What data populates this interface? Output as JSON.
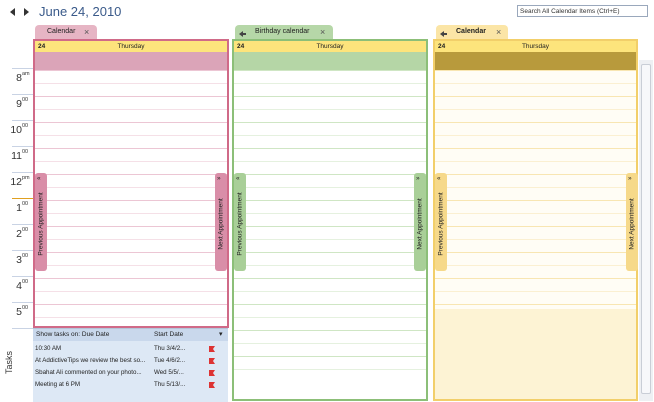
{
  "header": {
    "date_title": "June 24, 2010",
    "search_placeholder": "Search All Calendar Items (Ctrl+E)"
  },
  "time_slots": [
    {
      "h": "8",
      "m": "am"
    },
    {
      "h": "9",
      "m": "00"
    },
    {
      "h": "10",
      "m": "00"
    },
    {
      "h": "11",
      "m": "00"
    },
    {
      "h": "12",
      "m": "pm"
    },
    {
      "h": "1",
      "m": "00"
    },
    {
      "h": "2",
      "m": "00"
    },
    {
      "h": "3",
      "m": "00"
    },
    {
      "h": "4",
      "m": "00"
    },
    {
      "h": "5",
      "m": "00"
    }
  ],
  "tasks_label": "Tasks",
  "calendars": [
    {
      "tab_label": "Calendar",
      "day_number": "24",
      "day_name": "Thursday",
      "prev_label": "Previous Appointment",
      "next_label": "Next Appointment",
      "colors": {
        "tab": "#e6b5c4",
        "border": "#d06a88",
        "allday": "#dba4b8",
        "line": "#ecc6d4",
        "nav": "#d98ea8"
      }
    },
    {
      "tab_label": "Birthday calendar",
      "day_number": "24",
      "day_name": "Thursday",
      "prev_label": "Previous Appointment",
      "next_label": "Next Appointment",
      "colors": {
        "tab": "#b6d7a8",
        "border": "#8cbf78",
        "allday": "#b5d6a6",
        "line": "#cfe6c4",
        "nav": "#a9cf98"
      }
    },
    {
      "tab_label": "Calendar",
      "day_number": "24",
      "day_name": "Thursday",
      "prev_label": "Previous Appointment",
      "next_label": "Next Appointment",
      "colors": {
        "tab": "#fbe5a6",
        "border": "#f2cf6a",
        "allday": "#b89a3c",
        "line": "#f8e6b2",
        "nav": "#f6d98a"
      }
    }
  ],
  "task_pane": {
    "show_label": "Show tasks on: Due Date",
    "start_label": "Start Date",
    "rows": [
      {
        "subject": "10:30 AM",
        "start": "Thu 3/4/2..."
      },
      {
        "subject": "At AddictiveTips we review the best so...",
        "start": "Tue 4/6/2..."
      },
      {
        "subject": "Sbahat Ali commented on your photo...",
        "start": "Wed 5/5/..."
      },
      {
        "subject": "Meeting at 6 PM",
        "start": "Thu 5/13/..."
      }
    ]
  }
}
